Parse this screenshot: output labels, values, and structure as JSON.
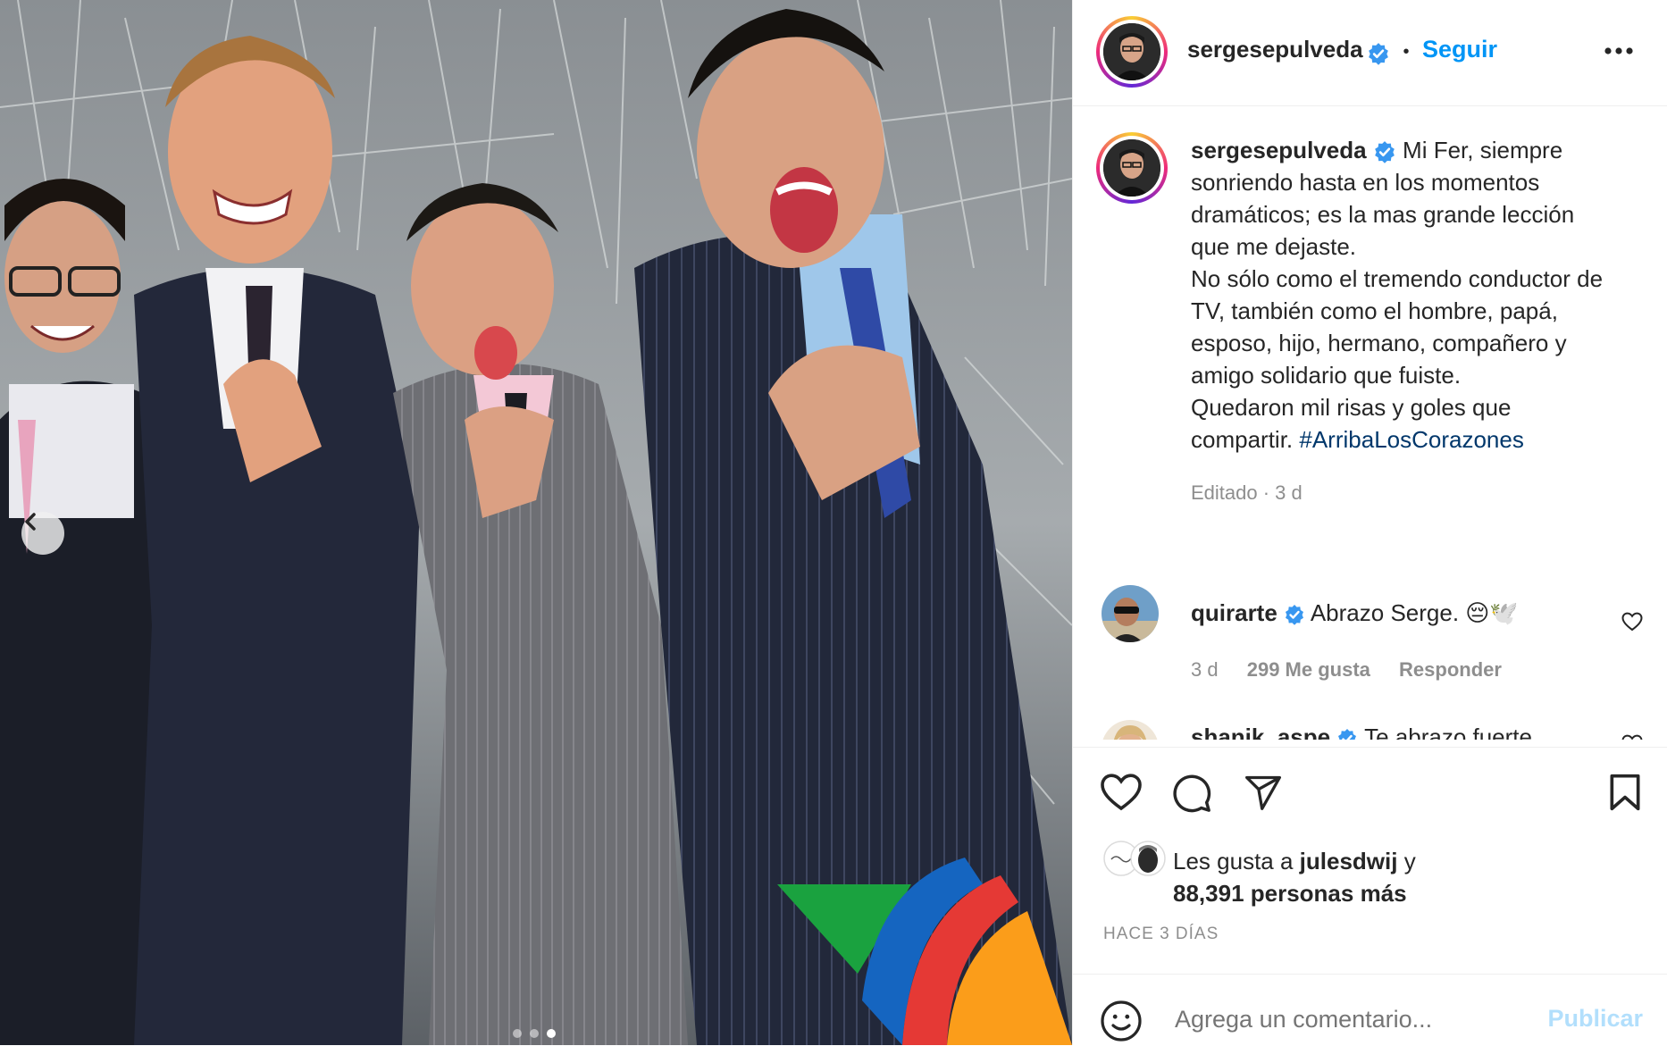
{
  "colors": {
    "accent": "#0095f6",
    "hashtag": "#00376b",
    "muted": "#8e8e8e",
    "publish_disabled": "#b2dffc"
  },
  "photo": {
    "carousel_dots": 3,
    "active_dot": 2,
    "nav_prev_icon": "chevron-left-icon",
    "logo_alt": "colorful stripes logo"
  },
  "header": {
    "username": "sergesepulveda",
    "separator": "•",
    "follow_label": "Seguir",
    "more_icon": "more-options-icon"
  },
  "caption": {
    "username": "sergesepulveda",
    "text": "Mi Fer, siempre sonriendo hasta en los momentos dramáticos; es la mas grande lección que me dejaste.",
    "text2": "No sólo como el tremendo conductor de TV, también como el hombre, papá, esposo, hijo, hermano, compañero y amigo solidario que fuiste.",
    "text3": "Quedaron mil risas y goles que compartir. ",
    "hashtag": "#ArribaLosCorazones",
    "meta": "Editado · 3 d"
  },
  "comments": [
    {
      "username": "quirarte",
      "text": "Abrazo Serge. 😔🕊️",
      "time": "3 d",
      "likes": "299 Me gusta",
      "reply": "Responder"
    },
    {
      "username": "shanik_aspe",
      "text": "Te abrazo fuerte"
    }
  ],
  "actions": {
    "like_icon": "heart-icon",
    "comment_icon": "comment-icon",
    "share_icon": "send-icon",
    "save_icon": "bookmark-icon"
  },
  "likes": {
    "prefix": "Les gusta a ",
    "user": "julesdwij",
    "mid": " y",
    "count": "88,391 personas más"
  },
  "timestamp": "HACE 3 DÍAS",
  "add_comment": {
    "placeholder": "Agrega un comentario...",
    "publish_label": "Publicar"
  }
}
